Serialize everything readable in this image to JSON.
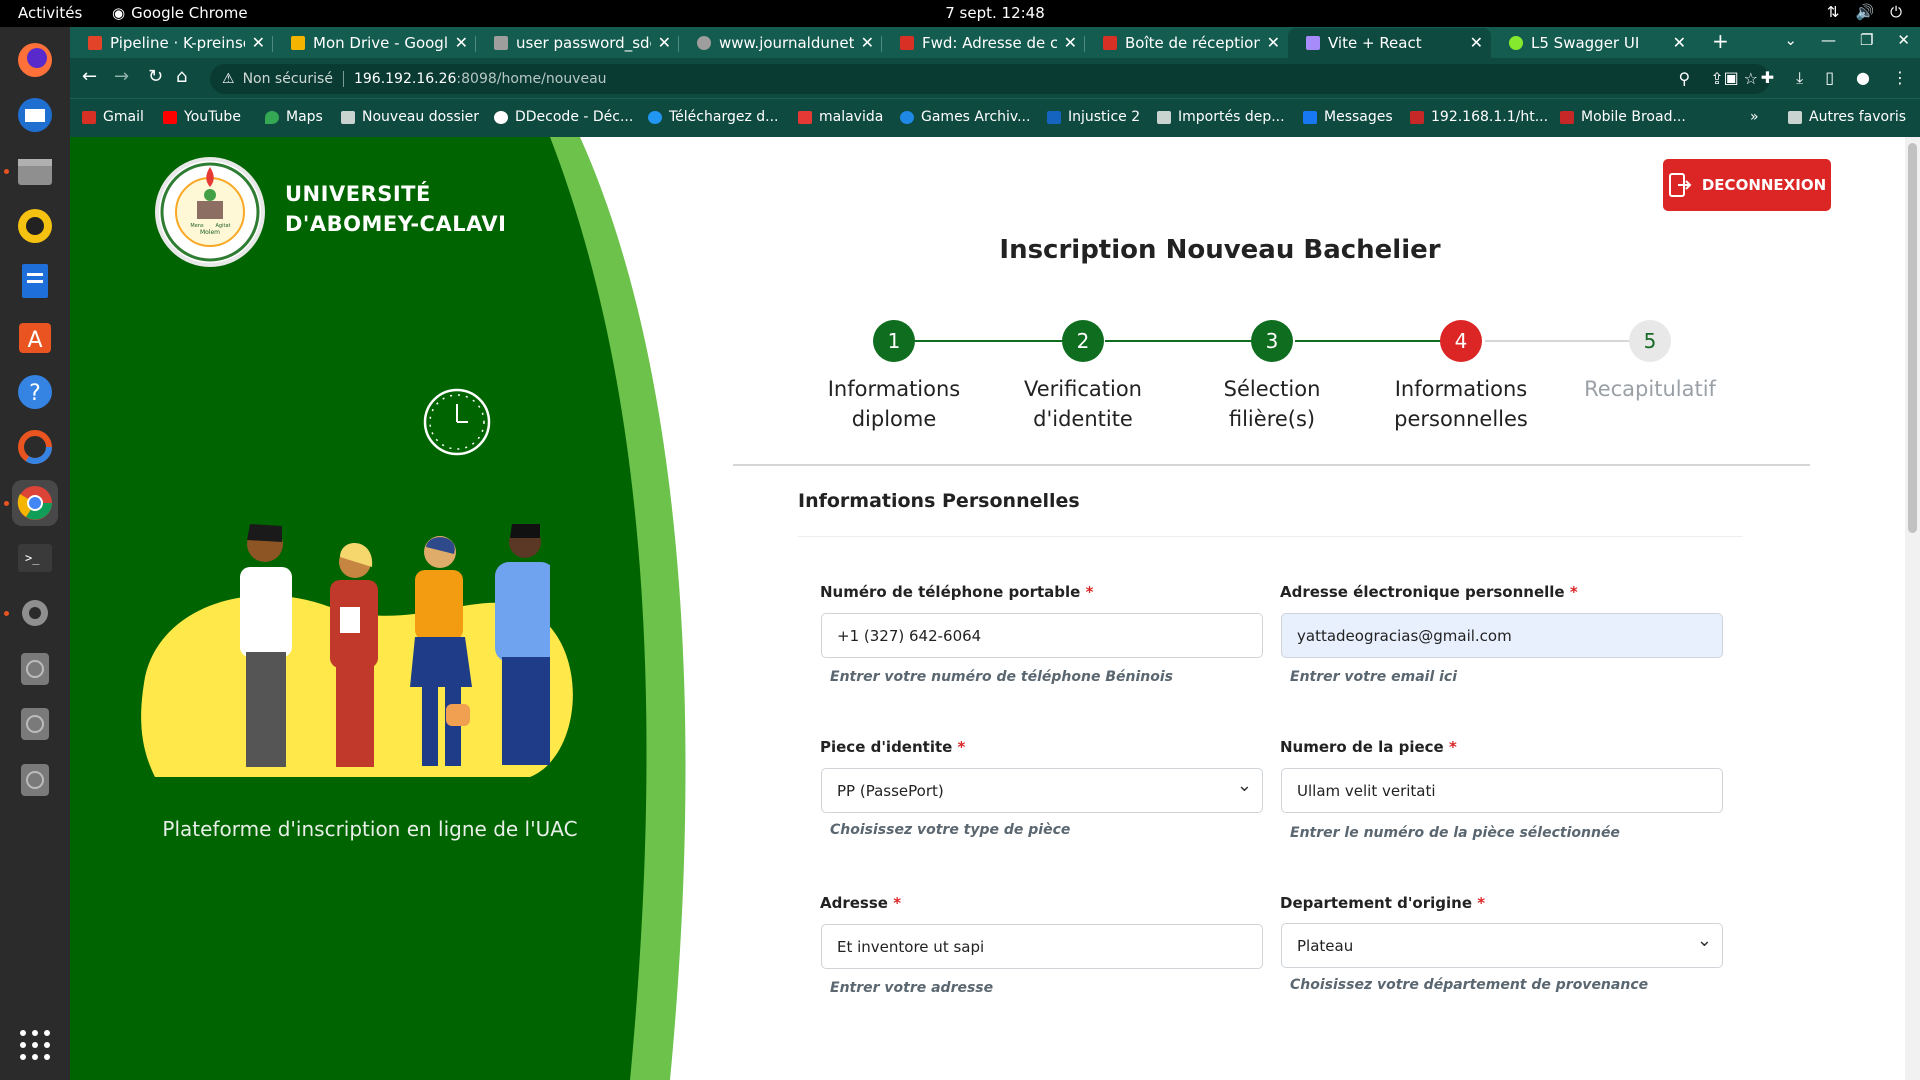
{
  "topbar": {
    "activities": "Activités",
    "app": "Google Chrome",
    "clock": "7 sept.  12:48"
  },
  "tabs": [
    {
      "title": "Pipeline · K-preinscri",
      "color": "#e24329"
    },
    {
      "title": "Mon Drive - Google D",
      "color": "#f4b400"
    },
    {
      "title": "user password_sdep",
      "color": "#9e9e9e"
    },
    {
      "title": "www.journaldunet.f",
      "color": "#9e9e9e"
    },
    {
      "title": "Fwd: Adresse de con",
      "color": "#d93025"
    },
    {
      "title": "Boîte de réception (",
      "color": "#d93025"
    },
    {
      "title": "Vite + React",
      "color": "#a78bfa"
    },
    {
      "title": "L5 Swagger UI",
      "color": "#85ea2d"
    }
  ],
  "address": {
    "warning": "Non sécurisé",
    "host": "196.192.16.26",
    "path": ":8098/home/nouveau"
  },
  "bookmarks": [
    {
      "label": "Gmail",
      "color": "#d93025"
    },
    {
      "label": "YouTube",
      "color": "#ff0000"
    },
    {
      "label": "Maps",
      "color": "#34a853"
    },
    {
      "label": "Nouveau dossier",
      "color": "#c9d4d1"
    },
    {
      "label": "DDecode - Déc...",
      "color": "#ffffff"
    },
    {
      "label": "Téléchargez d...",
      "color": "#2196f3"
    },
    {
      "label": "malavida",
      "color": "#e53935"
    },
    {
      "label": "Games Archiv...",
      "color": "#1e88e5"
    },
    {
      "label": "Injustice 2",
      "color": "#1565c0"
    },
    {
      "label": "Importés dep...",
      "color": "#c9d4d1"
    },
    {
      "label": "Messages",
      "color": "#1877f2"
    },
    {
      "label": "192.168.1.1/ht...",
      "color": "#c62828"
    },
    {
      "label": "Mobile Broad...",
      "color": "#c62828"
    }
  ],
  "bookmarks_more": "»",
  "bookmarks_other": "Autres favoris",
  "university": {
    "line1": "UNIVERSITÉ",
    "line2": "D'ABOMEY-CALAVI",
    "platform": "Plateforme d'inscription en ligne de l'UAC",
    "logo_text": "UNIVERSITÉ D'ABOMEY-CALAVI",
    "logo_motto_1": "Mens",
    "logo_motto_2": "Agitat",
    "logo_motto_3": "Molem"
  },
  "logout_label": "DECONNEXION",
  "page_title": "Inscription Nouveau Bachelier",
  "steps": [
    {
      "num": "1",
      "l1": "Informations",
      "l2": "diplome"
    },
    {
      "num": "2",
      "l1": "Verification",
      "l2": "d'identite"
    },
    {
      "num": "3",
      "l1": "Sélection",
      "l2": "filière(s)"
    },
    {
      "num": "4",
      "l1": "Informations",
      "l2": "personnelles"
    },
    {
      "num": "5",
      "l1": "Recapitulatif",
      "l2": ""
    }
  ],
  "current_step": 4,
  "section_title": "Informations Personnelles",
  "form": {
    "phone": {
      "label": "Numéro de téléphone portable",
      "value": "+1 (327) 642-6064",
      "hint": "Entrer votre numéro de téléphone Béninois"
    },
    "email": {
      "label": "Adresse électronique personnelle",
      "value": "yattadeogracias@gmail.com",
      "hint": "Entrer votre email ici"
    },
    "piece": {
      "label": "Piece d'identite",
      "value": "PP (PassePort)",
      "hint": "Choisissez votre type de pièce"
    },
    "numero": {
      "label": "Numero de la piece",
      "value": "Ullam velit veritati",
      "hint": "Entrer le numéro de la pièce sélectionnée"
    },
    "adresse": {
      "label": "Adresse",
      "value": "Et inventore ut sapi",
      "hint": "Entrer votre adresse"
    },
    "departement": {
      "label": "Departement d'origine",
      "value": "Plateau",
      "hint": "Choisissez votre département de provenance"
    }
  },
  "required_mark": "*",
  "colors": {
    "green": "#006400",
    "accent_green": "#6cc24a",
    "step_done": "#0f6d1f",
    "step_current": "#dc2626",
    "logout": "#dc2626"
  }
}
